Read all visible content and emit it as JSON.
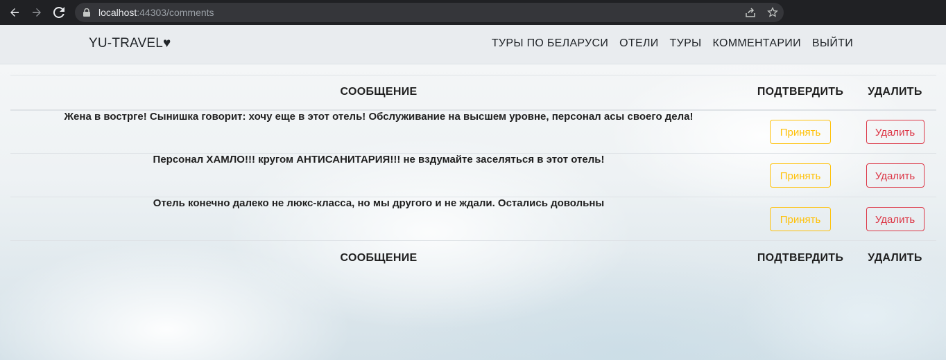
{
  "browser": {
    "url_host": "localhost",
    "url_rest": ":44303/comments"
  },
  "navbar": {
    "brand": "YU-TRAVEL♥",
    "links": [
      "ТУРЫ ПО БЕЛАРУСИ",
      "ОТЕЛИ",
      "ТУРЫ",
      "КОММЕНТАРИИ",
      "ВЫЙТИ"
    ]
  },
  "table": {
    "headers": {
      "message": "СООБЩЕНИЕ",
      "confirm": "ПОДТВЕРДИТЬ",
      "delete": "УДАЛИТЬ"
    },
    "rows": [
      {
        "message": "Жена в вострге! Сынишка говорит: хочу еще в этот отель! Обслуживание на высшем уровне, персонал асы своего дела!",
        "accept": "Принять",
        "delete": "Удалить"
      },
      {
        "message": "Персонал ХАМЛО!!! кругом АНТИСАНИТАРИЯ!!! не вздумайте заселяться в этот отель!",
        "accept": "Принять",
        "delete": "Удалить"
      },
      {
        "message": "Отель конечно далеко не люкс-класса, но мы другого и не ждали. Остались довольны",
        "accept": "Принять",
        "delete": "Удалить"
      }
    ]
  },
  "icons": [
    "back-icon",
    "forward-icon",
    "reload-icon",
    "lock-icon",
    "share-icon",
    "star-icon"
  ],
  "colors": {
    "accept": "#ffc107",
    "delete": "#dc3545",
    "navbar": "#e9ecef",
    "chrome": "#202124"
  }
}
